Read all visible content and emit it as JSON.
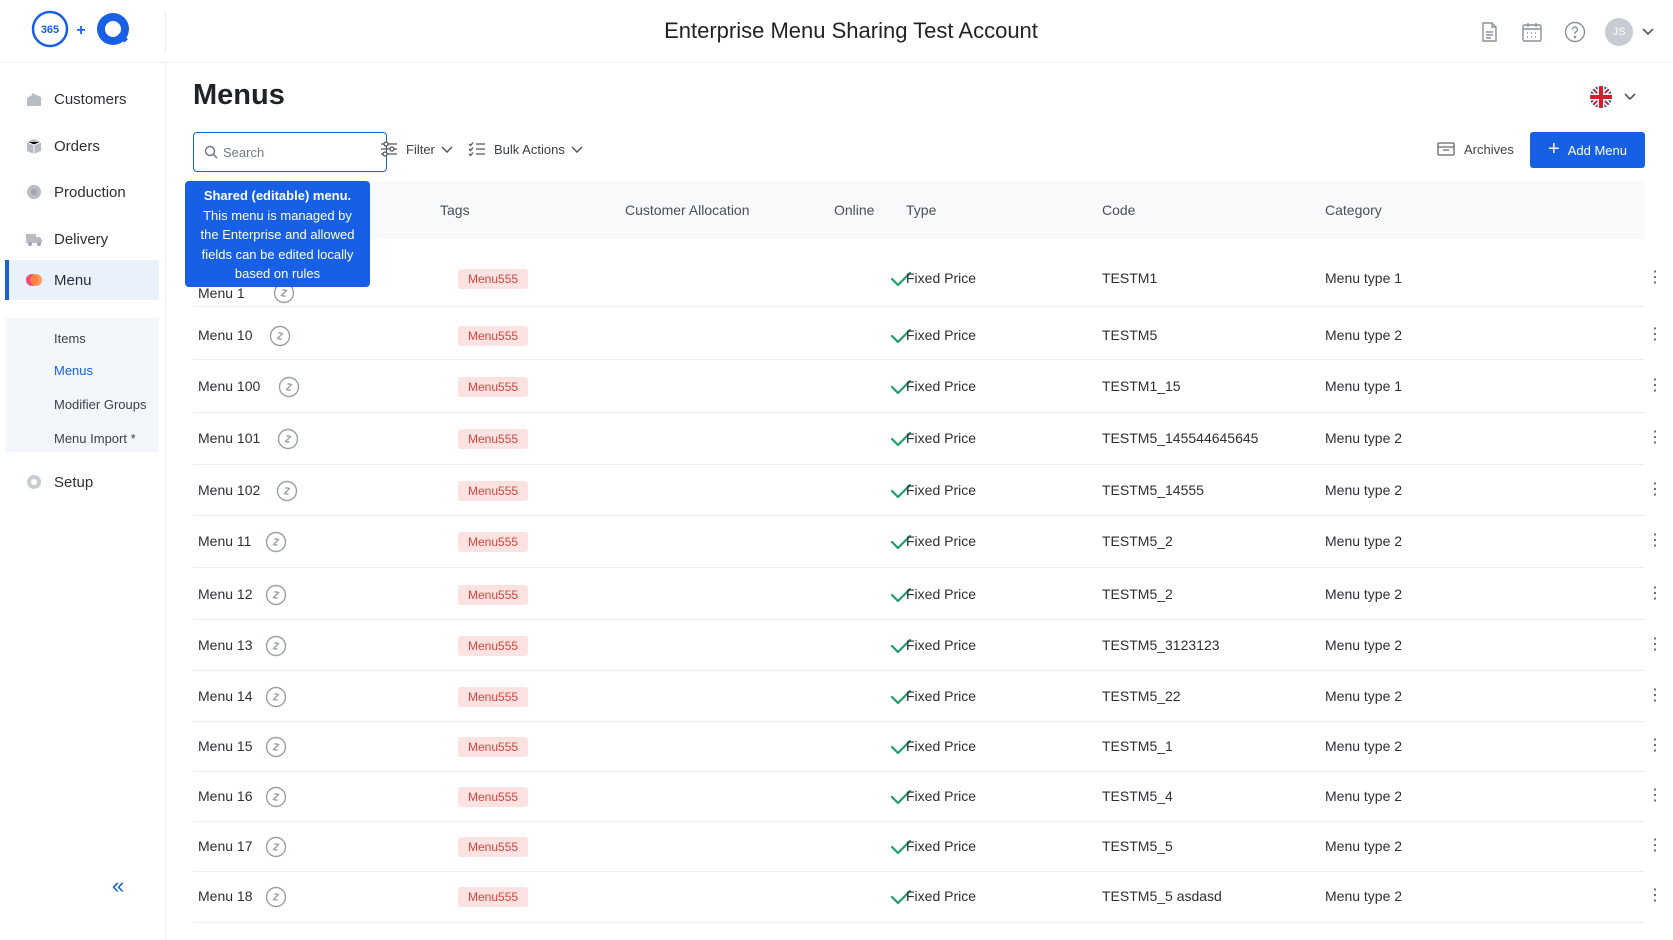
{
  "header": {
    "logo_text": "365",
    "logo_plus": "+",
    "title": "Enterprise Menu Sharing Test Account",
    "avatar_initials": "JS"
  },
  "sidebar": {
    "items": [
      {
        "label": "Customers",
        "icon": "building-icon"
      },
      {
        "label": "Orders",
        "icon": "box-icon"
      },
      {
        "label": "Production",
        "icon": "gear-icon"
      },
      {
        "label": "Delivery",
        "icon": "truck-icon"
      },
      {
        "label": "Menu",
        "icon": "menu-icon"
      },
      {
        "label": "Setup",
        "icon": "settings-icon"
      }
    ],
    "submenu": [
      {
        "label": "Items"
      },
      {
        "label": "Menus"
      },
      {
        "label": "Modifier Groups"
      },
      {
        "label": "Menu Import *"
      }
    ],
    "collapse_label": "«"
  },
  "main": {
    "title": "Menus",
    "search_placeholder": "Search",
    "filter_label": "Filter",
    "bulk_label": "Bulk Actions",
    "archives_label": "Archives",
    "add_label": "Add Menu",
    "add_plus": "+"
  },
  "tooltip": {
    "title": "Shared (editable) menu.",
    "body": "This menu is managed by the Enterprise and allowed fields can be edited locally based on rules"
  },
  "table": {
    "headers": [
      "Tags",
      "Customer Allocation",
      "Online",
      "Type",
      "Code",
      "Category"
    ],
    "rows": [
      {
        "name": "Menu 1",
        "tag": "Menu555",
        "type": "Fixed Price",
        "code": "TESTM1",
        "category": "Menu type 1"
      },
      {
        "name": "Menu 10",
        "tag": "Menu555",
        "type": "Fixed Price",
        "code": "TESTM5",
        "category": "Menu type 2"
      },
      {
        "name": "Menu 100",
        "tag": "Menu555",
        "type": "Fixed Price",
        "code": "TESTM1_15",
        "category": "Menu type 1"
      },
      {
        "name": "Menu 101",
        "tag": "Menu555",
        "type": "Fixed Price",
        "code": "TESTM5_145544645645",
        "category": "Menu type 2"
      },
      {
        "name": "Menu 102",
        "tag": "Menu555",
        "type": "Fixed Price",
        "code": "TESTM5_14555",
        "category": "Menu type 2"
      },
      {
        "name": "Menu 11",
        "tag": "Menu555",
        "type": "Fixed Price",
        "code": "TESTM5_2",
        "category": "Menu type 2"
      },
      {
        "name": "Menu 12",
        "tag": "Menu555",
        "type": "Fixed Price",
        "code": "TESTM5_2",
        "category": "Menu type 2"
      },
      {
        "name": "Menu 13",
        "tag": "Menu555",
        "type": "Fixed Price",
        "code": "TESTM5_3123123",
        "category": "Menu type 2"
      },
      {
        "name": "Menu 14",
        "tag": "Menu555",
        "type": "Fixed Price",
        "code": "TESTM5_22",
        "category": "Menu type 2"
      },
      {
        "name": "Menu 15",
        "tag": "Menu555",
        "type": "Fixed Price",
        "code": "TESTM5_1",
        "category": "Menu type 2"
      },
      {
        "name": "Menu 16",
        "tag": "Menu555",
        "type": "Fixed Price",
        "code": "TESTM5_4",
        "category": "Menu type 2"
      },
      {
        "name": "Menu 17",
        "tag": "Menu555",
        "type": "Fixed Price",
        "code": "TESTM5_5",
        "category": "Menu type 2"
      },
      {
        "name": "Menu 18",
        "tag": "Menu555",
        "type": "Fixed Price",
        "code": "TESTM5_5 asdasd",
        "category": "Menu type 2"
      }
    ]
  },
  "colors": {
    "accent": "#1760e6",
    "check": "#1f9d6b",
    "tag_bg": "#fde2e2",
    "tag_text": "#d6453d"
  }
}
